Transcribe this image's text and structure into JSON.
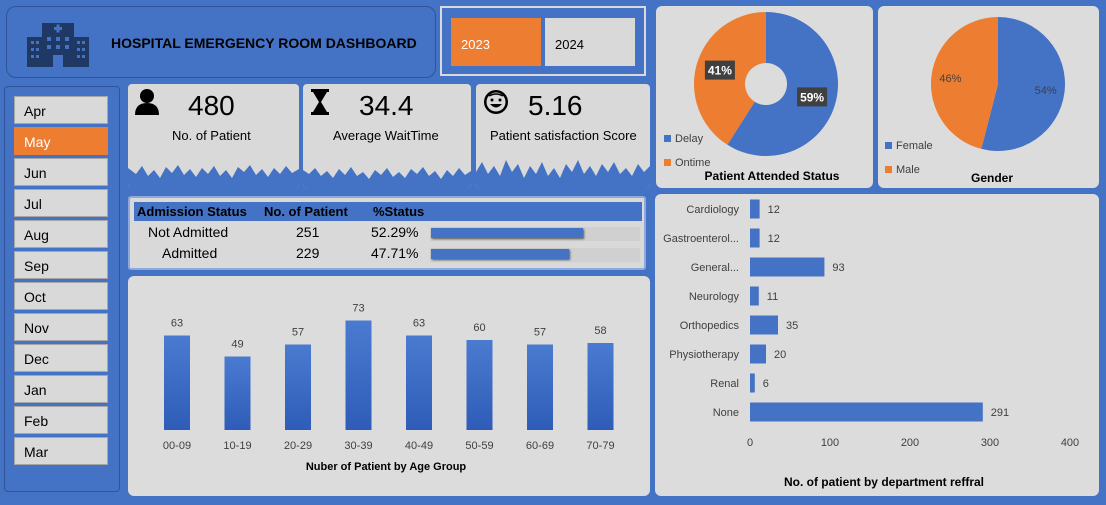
{
  "header": {
    "title": "HOSPITAL EMERGENCY ROOM DASHBOARD",
    "icon": "hospital-icon"
  },
  "years": {
    "items": [
      "2023",
      "2024"
    ],
    "selected": "2023"
  },
  "months": {
    "items": [
      "Apr",
      "May",
      "Jun",
      "Jul",
      "Aug",
      "Sep",
      "Oct",
      "Nov",
      "Dec",
      "Jan",
      "Feb",
      "Mar"
    ],
    "selected": "May"
  },
  "kpis": [
    {
      "value": "480",
      "label": "No. of Patient",
      "icon": "person-icon"
    },
    {
      "value": "34.4",
      "label": "Average WaitTime",
      "icon": "hourglass-icon"
    },
    {
      "value": "5.16",
      "label": "Patient satisfaction Score",
      "icon": "smiley-icon"
    }
  ],
  "admission": {
    "headers": [
      "Admission Status",
      "No. of Patient",
      "%Status"
    ],
    "rows": [
      {
        "status": "Not Admitted",
        "count": "251",
        "pct": "52.29%",
        "fraction": 0.5229
      },
      {
        "status": "Admitted",
        "count": "229",
        "pct": "47.71%",
        "fraction": 0.4771
      }
    ]
  },
  "colors": {
    "blue": "#4472c4",
    "orange": "#ed7d31",
    "panel": "#d9d9d9"
  },
  "chart_data": [
    {
      "type": "pie",
      "title": "Patient Attended Status",
      "donut": true,
      "categories": [
        "Delay",
        "Ontime"
      ],
      "values": [
        59,
        41
      ],
      "labels": [
        "59%",
        "41%"
      ],
      "colors": [
        "#4472c4",
        "#ed7d31"
      ],
      "legend": "bottom-left"
    },
    {
      "type": "pie",
      "title": "Gender",
      "categories": [
        "Female",
        "Male"
      ],
      "values": [
        54,
        46
      ],
      "labels": [
        "54%",
        "46%"
      ],
      "colors": [
        "#4472c4",
        "#ed7d31"
      ],
      "legend": "bottom-left"
    },
    {
      "type": "bar",
      "title": "Nuber of Patient by Age Group",
      "categories": [
        "00-09",
        "10-19",
        "20-29",
        "30-39",
        "40-49",
        "50-59",
        "60-69",
        "70-79"
      ],
      "values": [
        63,
        49,
        57,
        73,
        63,
        60,
        57,
        58
      ],
      "ylim": [
        0,
        80
      ],
      "grid": false
    },
    {
      "type": "bar",
      "orientation": "horizontal",
      "title": "No. of patient by department reffral",
      "categories": [
        "Cardiology",
        "Gastroenterol...",
        "General...",
        "Neurology",
        "Orthopedics",
        "Physiotherapy",
        "Renal",
        "None"
      ],
      "values": [
        12,
        12,
        93,
        11,
        35,
        20,
        6,
        291
      ],
      "xlim": [
        0,
        400
      ],
      "xticks": [
        "0",
        "100",
        "200",
        "300",
        "400"
      ],
      "grid": false
    }
  ]
}
